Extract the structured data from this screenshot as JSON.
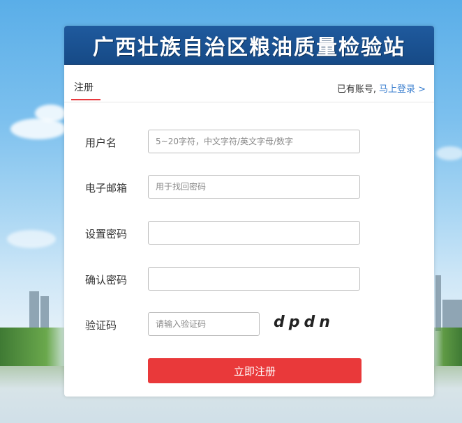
{
  "banner": {
    "title": "广西壮族自治区粮油质量检验站"
  },
  "tabs": {
    "register": "注册"
  },
  "login": {
    "hint": "已有账号,",
    "link": "马上登录 >"
  },
  "form": {
    "username": {
      "label": "用户名",
      "placeholder": "5~20字符，中文字符/英文字母/数字",
      "value": ""
    },
    "email": {
      "label": "电子邮箱",
      "placeholder": "用于找回密码",
      "value": ""
    },
    "password": {
      "label": "设置密码",
      "placeholder": "",
      "value": ""
    },
    "confirm": {
      "label": "确认密码",
      "placeholder": "",
      "value": ""
    },
    "captcha": {
      "label": "验证码",
      "placeholder": "请输入验证码",
      "value": "",
      "image_text": "dpdn"
    },
    "submit": "立即注册"
  },
  "colors": {
    "banner": "#164a86",
    "accent": "#e9393a",
    "link": "#3b7fcf"
  }
}
